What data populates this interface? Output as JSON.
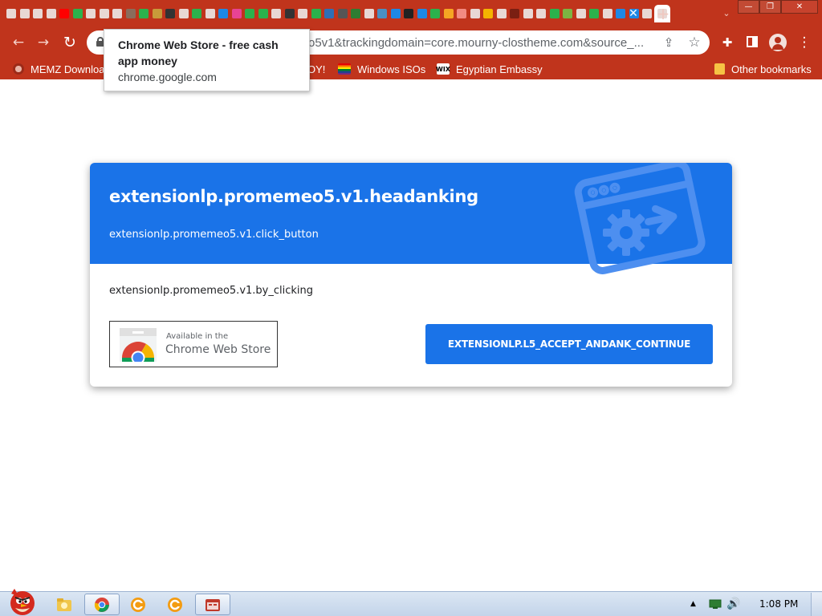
{
  "browser": {
    "tab_close_glyph": "✕",
    "new_tab_glyph": "+",
    "tab_search_glyph": "⌄",
    "window_buttons": {
      "minimize": "—",
      "restore": "❐",
      "close": "✕"
    },
    "favicon_colors": [
      "#e8d8d4",
      "#e8d8d4",
      "#e8d8d4",
      "#e8d8d4",
      "#ff0000",
      "#2bb24c",
      "#e8d8d4",
      "#e8d8d4",
      "#e8d8d4",
      "#8a6d5c",
      "#2bb24c",
      "#c89a3a",
      "#333333",
      "#e8d8d4",
      "#2bb24c",
      "#e8d8d4",
      "#1e88e5",
      "#e84393",
      "#2bb24c",
      "#2bb24c",
      "#e8d8d4",
      "#333333",
      "#e8d8d4",
      "#2bb24c",
      "#2f6fb5",
      "#555555",
      "#2e7d32",
      "#e8d8d4",
      "#4a90c2",
      "#1e88e5",
      "#222222",
      "#1e88e5",
      "#2bb24c",
      "#f5a623",
      "#f28b82",
      "#e8d8d4",
      "#f4b400",
      "#e8d8d4",
      "#7a1f12",
      "#e8d8d4",
      "#e8d8d4",
      "#2bb24c",
      "#7cb342",
      "#e8d8d4",
      "#2bb24c",
      "#e8d8d4",
      "#1e88e5",
      "#1e88e5",
      "#e8d8d4",
      "#e8d8d4"
    ],
    "active_tab_index": 49
  },
  "toolbar": {
    "back_glyph": "←",
    "forward_glyph": "→",
    "reload_glyph": "↻",
    "url_visible": "o5v1&trackingdomain=core.mourny-clostheme.com&source_...",
    "share_glyph": "⇪",
    "star_glyph": "☆",
    "extensions_glyph": "✚",
    "menu_glyph": "⋮"
  },
  "bookmarks": [
    {
      "label": "MEMZ Downloa",
      "icon": "memz-icon"
    },
    {
      "label": "OY!",
      "icon": "none"
    },
    {
      "label": "Windows ISOs",
      "icon": "rainbow-flag-icon"
    },
    {
      "label": "Egyptian Embassy",
      "icon": "wix-icon",
      "icon_text": "WIX"
    },
    {
      "label": "Other bookmarks",
      "icon": "folder-icon"
    }
  ],
  "tooltip": {
    "title": "Chrome Web Store - free cash app money",
    "url": "chrome.google.com"
  },
  "page": {
    "title": "extensionlp.promemeo5.v1.headanking",
    "subtitle": "extensionlp.promemeo5.v1.click_button",
    "body": "extensionlp.promemeo5.v1.by_clicking",
    "badge_small": "Available in the",
    "badge_big": "Chrome Web Store",
    "continue_label": "EXTENSIONLP.L5_ACCEPT_ANDANK_CONTINUE",
    "accent_color": "#1a73e8"
  },
  "taskbar": {
    "clock": "1:08 PM",
    "tray_arrow": "▲",
    "speaker_glyph": "🔊"
  }
}
